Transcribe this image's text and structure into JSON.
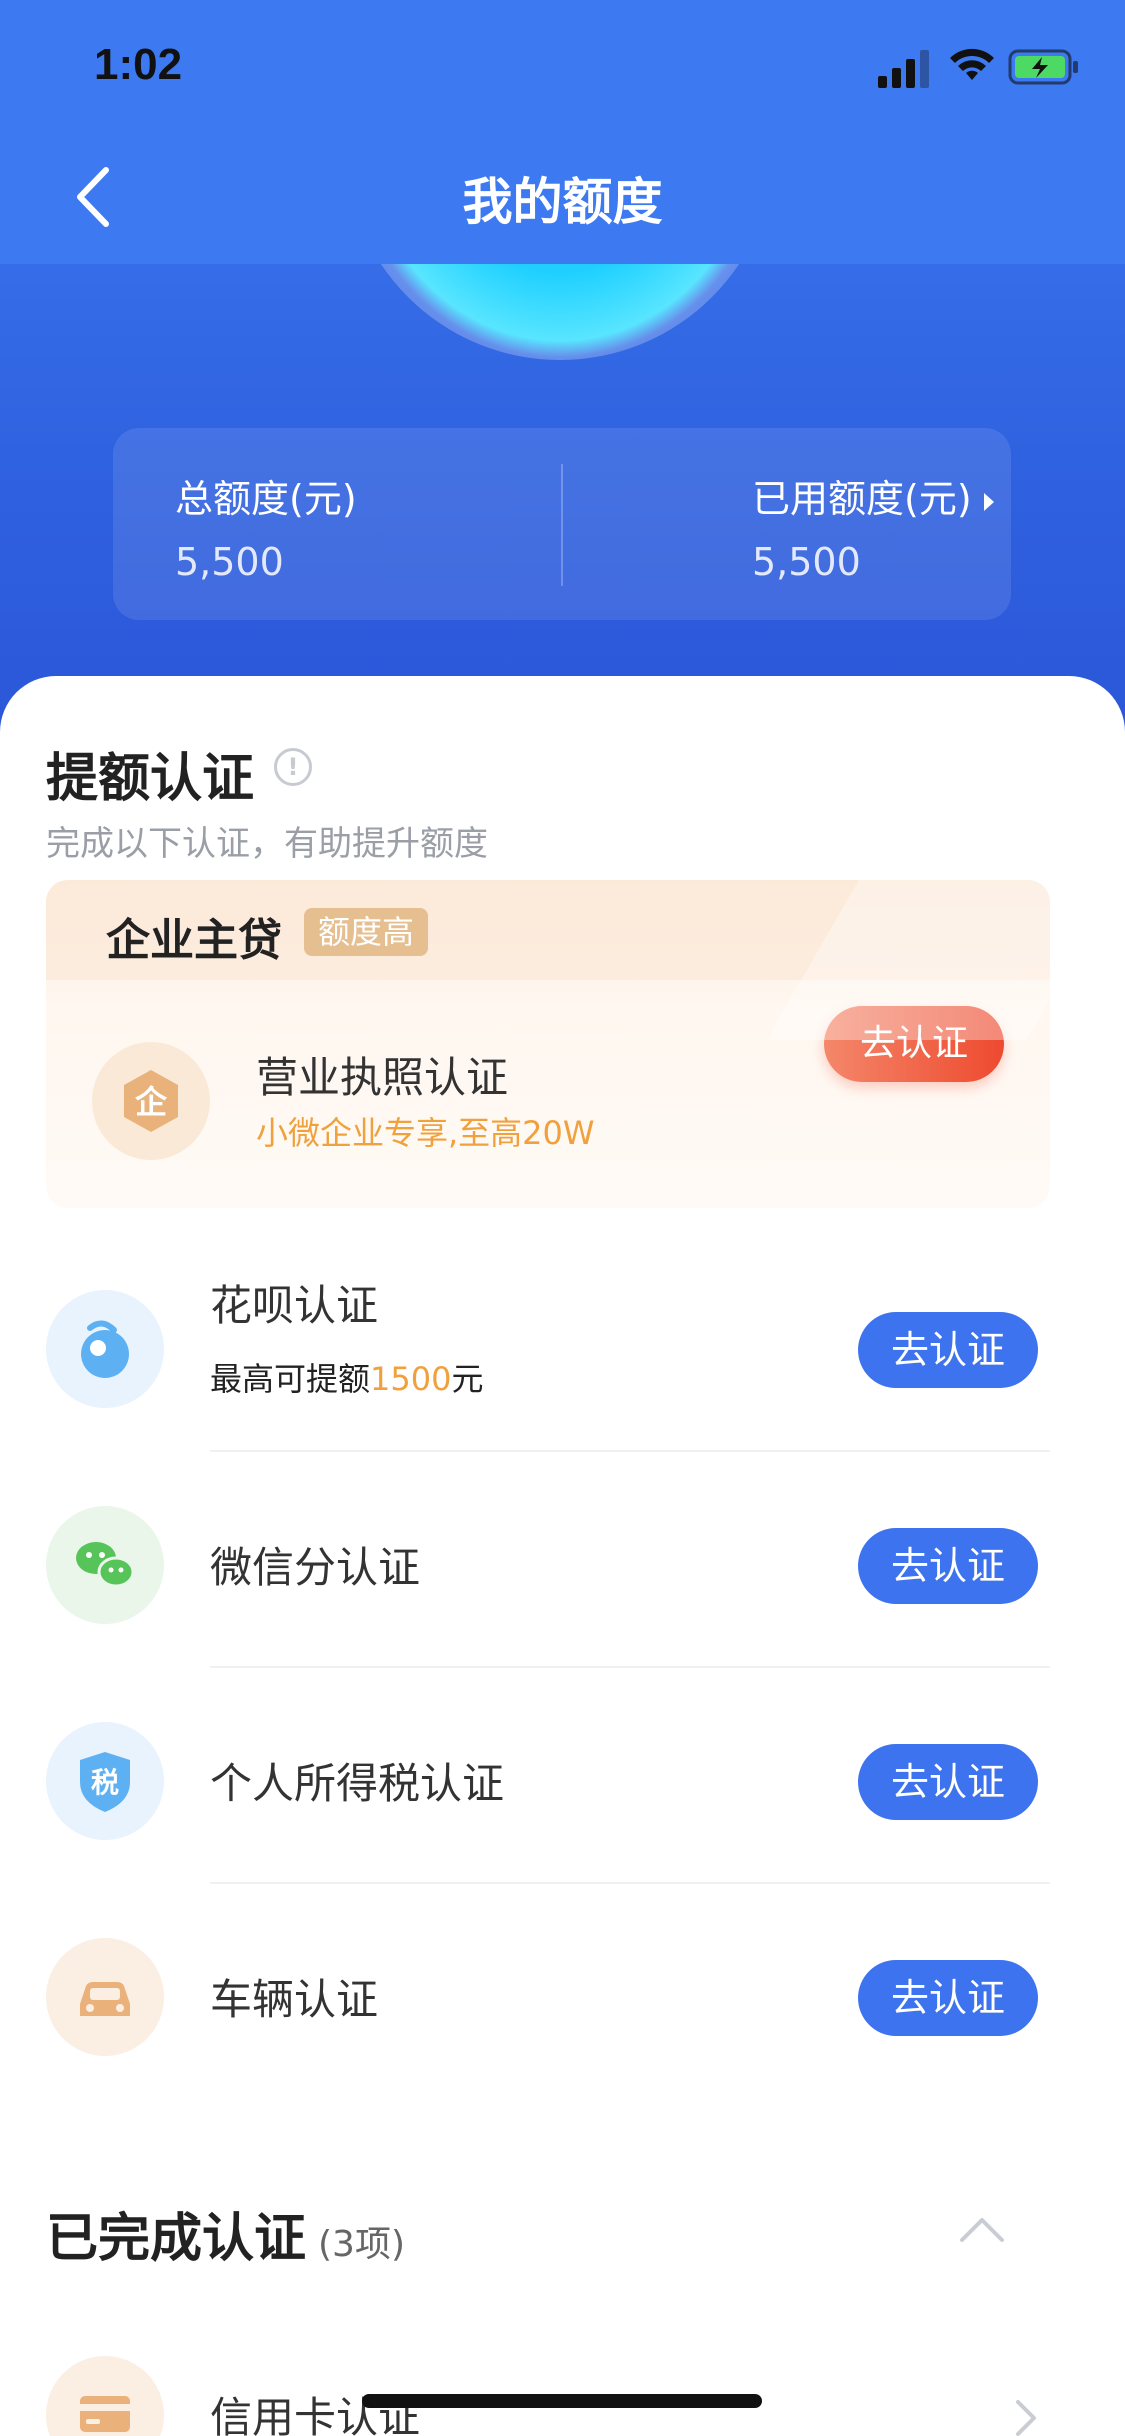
{
  "status_bar": {
    "time": "1:02"
  },
  "nav": {
    "title": "我的额度"
  },
  "colors": {
    "primary": "#3d73ee",
    "orange": "#f0a13e",
    "red_button": "#ee4a2f"
  },
  "stats": {
    "total_label": "总额度(元)",
    "total_value": "5,500",
    "used_label": "已用额度(元)",
    "used_value": "5,500"
  },
  "boost": {
    "title": "提额认证",
    "subtitle": "完成以下认证，有助提升额度",
    "business": {
      "title": "企业主贷",
      "badge": "额度高",
      "icon_text": "企",
      "name": "营业执照认证",
      "desc": "小微企业专享,至高20W",
      "button": "去认证"
    },
    "items": [
      {
        "name": "花呗认证",
        "sub_prefix": "最高可提额",
        "sub_highlight": "1500",
        "sub_suffix": "元",
        "button": "去认证",
        "icon": "huabei-icon"
      },
      {
        "name": "微信分认证",
        "button": "去认证",
        "icon": "wechat-icon"
      },
      {
        "name": "个人所得税认证",
        "button": "去认证",
        "icon_text": "税",
        "icon": "tax-shield-icon"
      },
      {
        "name": "车辆认证",
        "button": "去认证",
        "icon": "car-icon"
      }
    ]
  },
  "completed": {
    "title": "已完成认证",
    "count": "(3项)",
    "first_item": "信用卡认证"
  }
}
